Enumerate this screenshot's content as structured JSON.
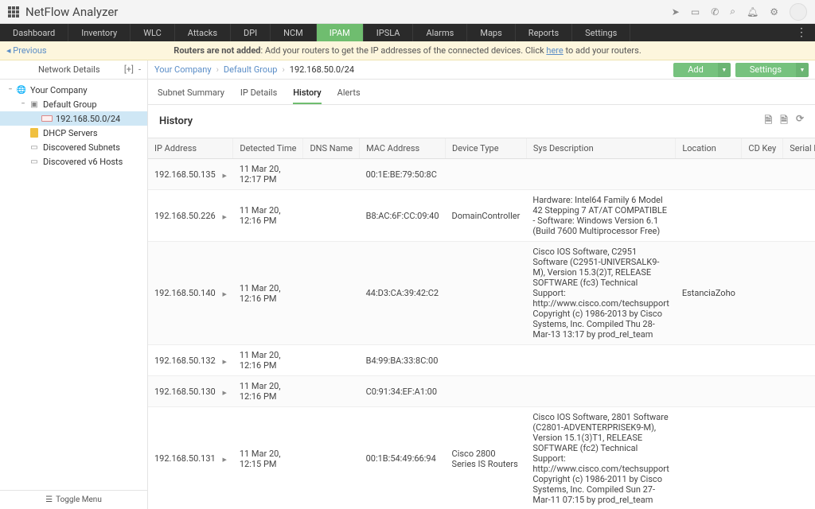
{
  "app": {
    "title": "NetFlow Analyzer"
  },
  "topIcons": [
    "rocket",
    "monitor",
    "headset",
    "search",
    "bell",
    "gear"
  ],
  "menu": {
    "items": [
      "Dashboard",
      "Inventory",
      "WLC",
      "Attacks",
      "DPI",
      "NCM",
      "IPAM",
      "IPSLA",
      "Alarms",
      "Maps",
      "Reports",
      "Settings"
    ],
    "active": "IPAM"
  },
  "banner": {
    "previous": "Previous",
    "bold": "Routers are not added",
    "rest1": ": Add your routers to get the IP addresses of the connected devices. Click ",
    "link": "here",
    "rest2": " to add your routers."
  },
  "sidebar": {
    "header": "Network Details",
    "plus": "[+]",
    "minus": "-",
    "toggle": "Toggle Menu",
    "tree": [
      {
        "label": "Your Company",
        "depth": 0,
        "icon": "globe",
        "expandable": true,
        "toggleChar": "−"
      },
      {
        "label": "Default Group",
        "depth": 1,
        "icon": "folder",
        "expandable": true,
        "toggleChar": "−"
      },
      {
        "label": "192.168.50.0/24",
        "depth": 2,
        "icon": "subnet",
        "selected": true
      },
      {
        "label": "DHCP Servers",
        "depth": 1,
        "icon": "dhcp"
      },
      {
        "label": "Discovered Subnets",
        "depth": 1,
        "icon": "disc"
      },
      {
        "label": "Discovered v6 Hosts",
        "depth": 1,
        "icon": "disc"
      }
    ]
  },
  "breadcrumb": [
    "Your Company",
    "Default Group",
    "192.168.50.0/24"
  ],
  "buttons": {
    "add": "Add",
    "settings": "Settings"
  },
  "tabs": {
    "items": [
      "Subnet Summary",
      "IP Details",
      "History",
      "Alerts"
    ],
    "active": "History"
  },
  "panel": {
    "title": "History"
  },
  "columns": [
    "IP Address",
    "Detected Time",
    "DNS Name",
    "MAC Address",
    "Device Type",
    "Sys Description",
    "Location",
    "CD Key",
    "Serial Num"
  ],
  "rows": [
    {
      "ip": "192.168.50.135",
      "detected": "11 Mar 20, 12:17 PM",
      "dns": "",
      "mac": "00:1E:BE:79:50:8C",
      "device": "",
      "sys": "",
      "loc": "",
      "cd": ""
    },
    {
      "ip": "192.168.50.226",
      "detected": "11 Mar 20, 12:16 PM",
      "dns": "",
      "mac": "B8:AC:6F:CC:09:40",
      "device": "DomainController",
      "sys": "Hardware: Intel64 Family 6 Model 42 Stepping 7 AT/AT COMPATIBLE - Software: Windows Version 6.1 (Build 7600 Multiprocessor Free)",
      "loc": "",
      "cd": ""
    },
    {
      "ip": "192.168.50.140",
      "detected": "11 Mar 20, 12:16 PM",
      "dns": "",
      "mac": "44:D3:CA:39:42:C2",
      "device": "",
      "sys": "Cisco IOS Software, C2951 Software (C2951-UNIVERSALK9-M), Version 15.3(2)T, RELEASE SOFTWARE (fc3) Technical Support: http://www.cisco.com/techsupport Copyright (c) 1986-2013 by Cisco Systems, Inc. Compiled Thu 28-Mar-13 13:17 by prod_rel_team",
      "loc": "EstanciaZoho",
      "cd": ""
    },
    {
      "ip": "192.168.50.132",
      "detected": "11 Mar 20, 12:16 PM",
      "dns": "",
      "mac": "B4:99:BA:33:8C:00",
      "device": "",
      "sys": "",
      "loc": "",
      "cd": ""
    },
    {
      "ip": "192.168.50.130",
      "detected": "11 Mar 20, 12:16 PM",
      "dns": "",
      "mac": "C0:91:34:EF:A1:00",
      "device": "",
      "sys": "",
      "loc": "",
      "cd": ""
    },
    {
      "ip": "192.168.50.131",
      "detected": "11 Mar 20, 12:15 PM",
      "dns": "",
      "mac": "00:1B:54:49:66:94",
      "device": "Cisco 2800 Series IS Routers",
      "sys": "Cisco IOS Software, 2801 Software (C2801-ADVENTERPRISEK9-M), Version 15.1(3)T1, RELEASE SOFTWARE (fc2) Technical Support: http://www.cisco.com/techsupport Copyright (c) 1986-2011 by Cisco Systems, Inc. Compiled Sun 27-Mar-11 07:15 by prod_rel_team",
      "loc": "",
      "cd": ""
    }
  ]
}
